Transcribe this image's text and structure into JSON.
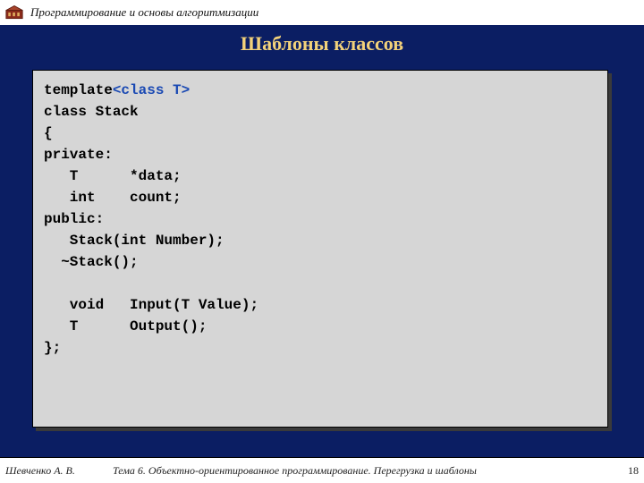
{
  "header": {
    "course_title": "Программирование и основы алгоритмизации"
  },
  "slide": {
    "title": "Шаблоны классов"
  },
  "code": {
    "line1_prefix": "template",
    "line1_tparam": "<class T>",
    "line2": "class Stack",
    "line3": "{",
    "line4": "private:",
    "line5": "   T      *data;",
    "line6": "   int    count;",
    "line7": "public:",
    "line8": "   Stack(int Number);",
    "line9": "  ~Stack();",
    "line10": "",
    "line11": "   void   Input(T Value);",
    "line12": "   T      Output();",
    "line13": "};"
  },
  "footer": {
    "author": "Шевченко А. В.",
    "topic": "Тема 6. Объектно-ориентированное программирование. Перегрузка и шаблоны",
    "page": "18"
  }
}
